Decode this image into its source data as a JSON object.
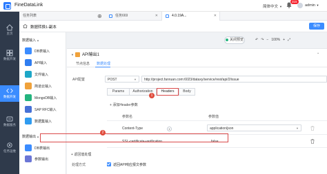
{
  "app": {
    "title": "FineDataLink"
  },
  "header": {
    "language": "简体中文",
    "notification_count": "315",
    "user": "admin"
  },
  "rail": [
    {
      "label": "主页"
    },
    {
      "label": "数据开发"
    },
    {
      "label": "数据开发"
    },
    {
      "label": "数据服务"
    },
    {
      "label": "任务运维"
    }
  ],
  "tabs": [
    {
      "label": "任务列表"
    },
    {
      "label": "任务669"
    },
    {
      "label": "4.0.19A..."
    }
  ],
  "tabs_more": "»",
  "breadcrumb": "数据转换1-副本",
  "save_label": "保存",
  "left_panel": {
    "input_section": "数据输入",
    "input_items": [
      {
        "label": "DB表输入"
      },
      {
        "label": "API输入"
      },
      {
        "label": "文件输入"
      },
      {
        "label": "简道云输入"
      },
      {
        "label": "MongoDB输入"
      },
      {
        "label": "SAP RFC输入"
      },
      {
        "label": "数据集输入"
      }
    ],
    "output_section": "数据输出",
    "output_items": [
      {
        "label": "DB表输出"
      },
      {
        "label": "参数输出"
      }
    ]
  },
  "canvas": {
    "preview_label": "关闭预览",
    "zoom_level": "100%"
  },
  "card": {
    "title": "API输出1",
    "tabs": [
      {
        "label": "节点信息"
      },
      {
        "label": "数据处理"
      }
    ],
    "api_config_label": "API配置",
    "method": "POST",
    "url": "http://project.fanruan.com:6023/dataxy/service/rest/api/2/issue",
    "sub_tabs": [
      {
        "label": "Params"
      },
      {
        "label": "Authorization"
      },
      {
        "label": "Headers"
      },
      {
        "label": "Body"
      }
    ],
    "add_header": "添加Header参数",
    "col_param": "参数名",
    "col_value": "参数值",
    "rows": [
      {
        "name": "Content-Type",
        "value": "application/json"
      },
      {
        "name": "SSL-certificate-verification",
        "value": "false"
      }
    ],
    "expand_label": "返回值处理",
    "handle_label": "处理方式",
    "checkbox_label": "返回API响应报文参数"
  },
  "markers": [
    "1",
    "2"
  ],
  "colors": {
    "accent": "#3b8cff",
    "highlight": "#d94a4a",
    "rail": "#2f3a4b"
  }
}
